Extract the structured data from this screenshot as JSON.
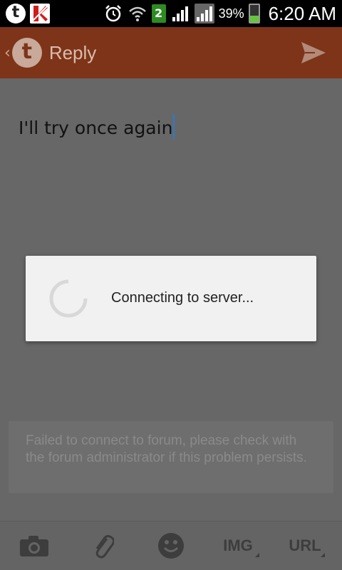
{
  "status_bar": {
    "battery_percent": "39%",
    "time": "6:20 AM",
    "notification_count": "2",
    "icons": [
      "tapatalk-icon",
      "kaspersky-icon",
      "alarm-icon",
      "wifi-icon",
      "notification-badge",
      "signal-icon",
      "signal-icon",
      "battery-icon"
    ],
    "battery_color": "#64c63a",
    "battery_level": 0.39
  },
  "header": {
    "title": "Reply",
    "brand_color": "#7e3418",
    "logo_letter": "t"
  },
  "editor": {
    "text": "I'll try once again"
  },
  "dialog": {
    "message": "Connecting to server..."
  },
  "error": {
    "message": "Failed to connect to forum, please check with the forum administrator if this problem persists."
  },
  "toolbar": {
    "img_label": "IMG",
    "url_label": "URL",
    "icons": [
      "camera-icon",
      "paperclip-icon",
      "smiley-icon"
    ]
  }
}
